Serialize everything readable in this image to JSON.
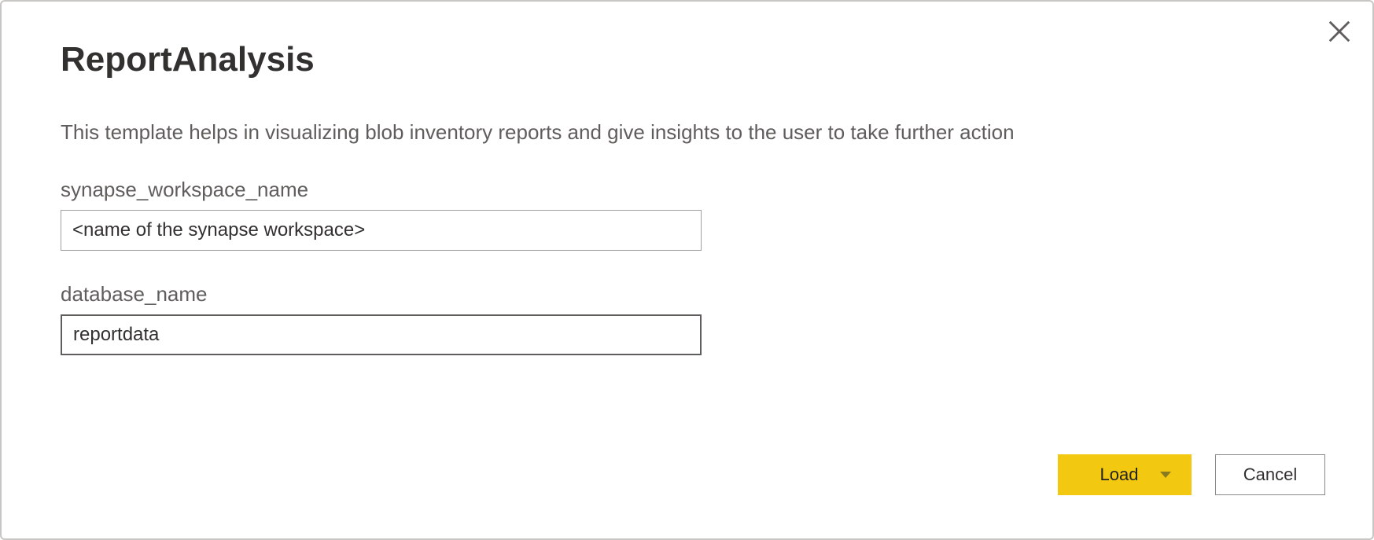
{
  "dialog": {
    "title": "ReportAnalysis",
    "description": "This template helps in visualizing blob inventory reports and give insights to the user to take further action",
    "fields": {
      "synapse_workspace_name": {
        "label": "synapse_workspace_name",
        "value": "<name of the synapse workspace>"
      },
      "database_name": {
        "label": "database_name",
        "value": "reportdata"
      }
    },
    "buttons": {
      "load": "Load",
      "cancel": "Cancel"
    }
  }
}
